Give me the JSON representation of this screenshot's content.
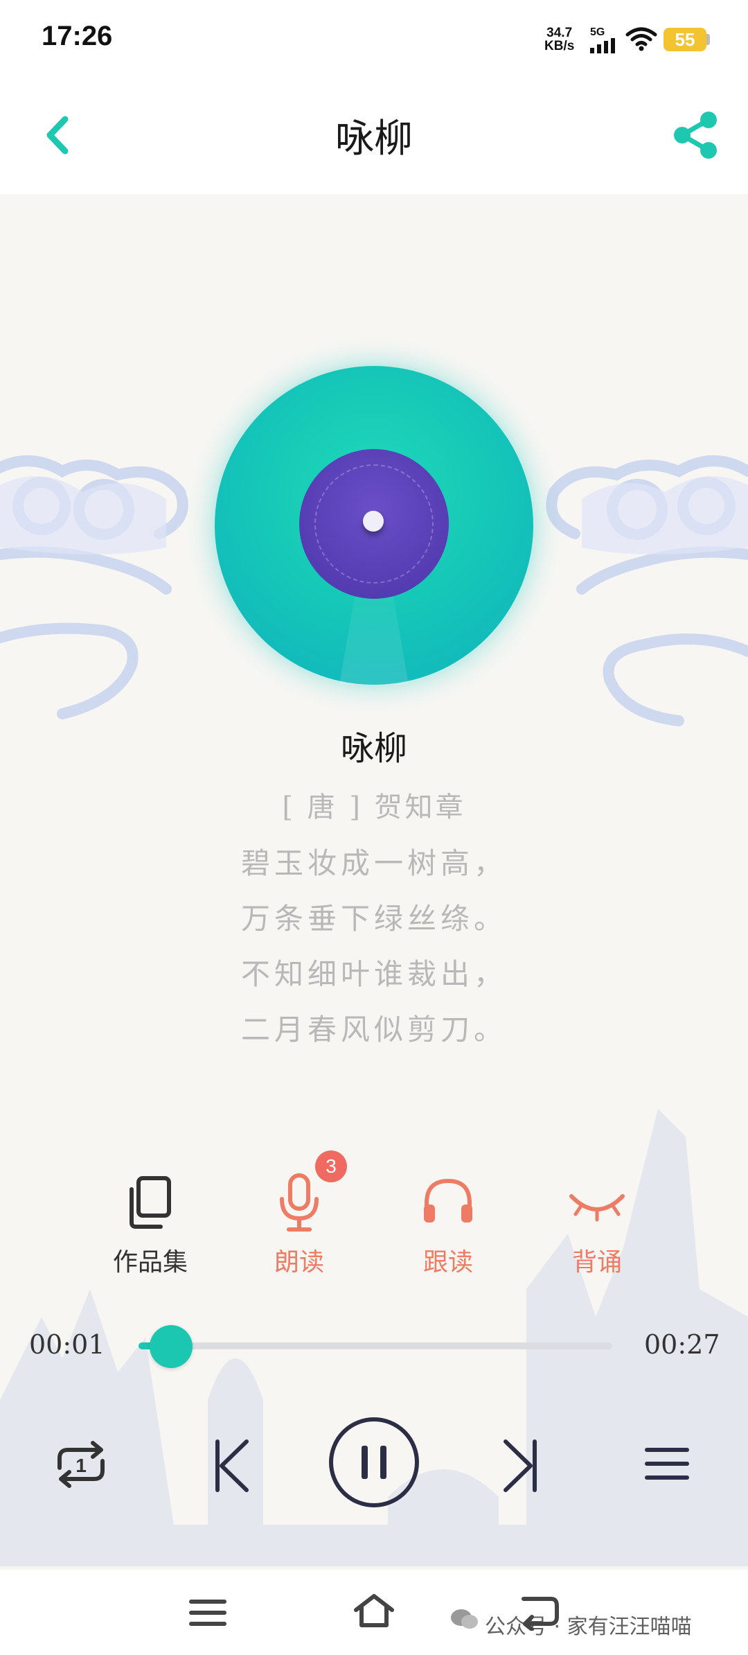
{
  "status_bar": {
    "time": "17:26",
    "net_speed_value": "34.7",
    "net_speed_unit": "KB/s",
    "signal_label": "5G",
    "battery": "55"
  },
  "header": {
    "title": "咏柳",
    "back_icon": "chevron-left-icon",
    "share_icon": "share-icon"
  },
  "poem": {
    "title": "咏柳",
    "author": "[ 唐 ] 贺知章",
    "lines": [
      "碧玉妆成一树高，",
      "万条垂下绿丝绦。",
      "不知细叶谁裁出，",
      "二月春风似剪刀。"
    ]
  },
  "functions": [
    {
      "label": "作品集",
      "icon": "collection-icon",
      "color": "#333333"
    },
    {
      "label": "朗读",
      "icon": "microphone-icon",
      "badge": "3",
      "color": "#ee7b64"
    },
    {
      "label": "跟读",
      "icon": "headphones-icon",
      "color": "#ee7b64"
    },
    {
      "label": "背诵",
      "icon": "closed-eye-icon",
      "color": "#ee7b64"
    }
  ],
  "player": {
    "current_time": "00:01",
    "total_time": "00:27",
    "progress": 0.04
  },
  "colors": {
    "accent": "#1cc7b2",
    "function_active": "#ee7b64",
    "record_label": "#4b34a8"
  },
  "watermark": "公众号 · 家有汪汪喵喵"
}
